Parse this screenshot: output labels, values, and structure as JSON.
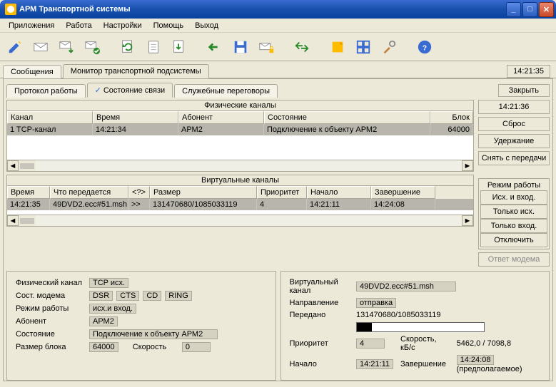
{
  "window": {
    "title": "АРМ Транспортной системы"
  },
  "menu": [
    "Приложения",
    "Работа",
    "Настройки",
    "Помощь",
    "Выход"
  ],
  "header_time": "14:21:35",
  "tabs_main": {
    "t1": "Сообщения",
    "t2": "Монитор транспортной подсистемы",
    "active": 1
  },
  "btn_close": "Закрыть",
  "tabs_sub": {
    "t1": "Протокол работы",
    "t2": "Состояние связи",
    "t3": "Служебные переговоры",
    "active": 1
  },
  "side": {
    "time": "14:21:36",
    "reset": "Сброс",
    "hold": "Удержание",
    "release": "Снять с передачи",
    "answer": "Ответ модема"
  },
  "mode": {
    "title": "Режим работы",
    "b1": "Исх. и вход.",
    "b2": "Только исх.",
    "b3": "Только вход.",
    "b4": "Отключить"
  },
  "phys": {
    "title": "Физические каналы",
    "headers": {
      "c1": "Канал",
      "c2": "Время",
      "c3": "Абонент",
      "c4": "Состояние",
      "c5": "Блок"
    },
    "rows": [
      {
        "c1": "1 TCP-канал",
        "c2": "14:21:34",
        "c3": "АРМ2",
        "c4": "Подключение к объекту АРМ2",
        "c5": "64000"
      }
    ]
  },
  "virt": {
    "title": "Виртуальные каналы",
    "headers": {
      "c1": "Время",
      "c2": "Что передается",
      "c3": "<?>",
      "c4": "Размер",
      "c5": "Приоритет",
      "c6": "Начало",
      "c7": "Завершение"
    },
    "rows": [
      {
        "c1": "14:21:35",
        "c2": "49DVD2.ecc#51.msh",
        "c3": ">>",
        "c4": "131470680/1085033119",
        "c5": "4",
        "c6": "14:21:11",
        "c7": "14:24:08"
      }
    ]
  },
  "status_left": {
    "l1": "Физический канал",
    "v1": "TCP исх.",
    "l2": "Сост. модема",
    "chips": [
      "DSR",
      "CTS",
      "CD",
      "RING"
    ],
    "l3": "Режим работы",
    "v3": "исх.и вход.",
    "l4": "Абонент",
    "v4": "АРМ2",
    "l5": "Состояние",
    "v5": "Подключение к объекту АРМ2",
    "l6": "Размер блока",
    "v6": "64000",
    "l7": "Скорость",
    "v7": "0"
  },
  "status_right": {
    "l1": "Виртуальный канал",
    "v1": "49DVD2.ecc#51.msh",
    "l2": "Направление",
    "v2": "отправка",
    "l3": "Передано",
    "v3": "131470680/1085033119",
    "pct": "12%",
    "l4": "Приоритет",
    "v4": "4",
    "l5": "Скорость, кБ/с",
    "v5": "5462,0 / 7098,8",
    "l6": "Начало",
    "v6": "14:21:11",
    "l7": "Завершение",
    "v7": "14:24:08",
    "l8": "(предполагаемое)"
  }
}
